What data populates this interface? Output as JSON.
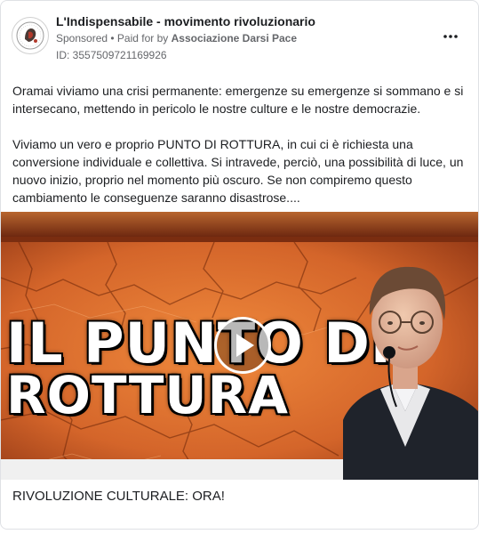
{
  "ad": {
    "page_name": "L'Indispensabile - movimento rivoluzionario",
    "sponsored_label": "Sponsored",
    "separator": " • ",
    "paid_for_text": "Paid for by ",
    "paid_for_name": "Associazione Darsi Pace",
    "id_text": "ID: 3557509721169926",
    "more_icon": "more-horizontal-icon",
    "avatar_icon": "page-logo-icon"
  },
  "body": {
    "paragraph_1": "Oramai viviamo una crisi permanente: emergenze su emergenze si sommano e si intersecano, mettendo in pericolo le nostre culture e le nostre democrazie.",
    "paragraph_2": "Viviamo un vero e proprio PUNTO DI ROTTURA, in cui ci è richiesta una conversione individuale e collettiva. Si intravede, perciò, una possibilità di luce, un nuovo inizio, proprio nel momento più oscuro. Se non compiremo questo cambiamento le conseguenze saranno disastrose...."
  },
  "media": {
    "title_line_1": "IL PUNTO DI",
    "title_line_2": "ROTTURA",
    "play_icon": "play-icon",
    "colors": {
      "orange": "#e8742c",
      "dark_orange": "#a9431a",
      "jacket": "#20242c"
    }
  },
  "caption": "RIVOLUZIONE CULTURALE: ORA!"
}
